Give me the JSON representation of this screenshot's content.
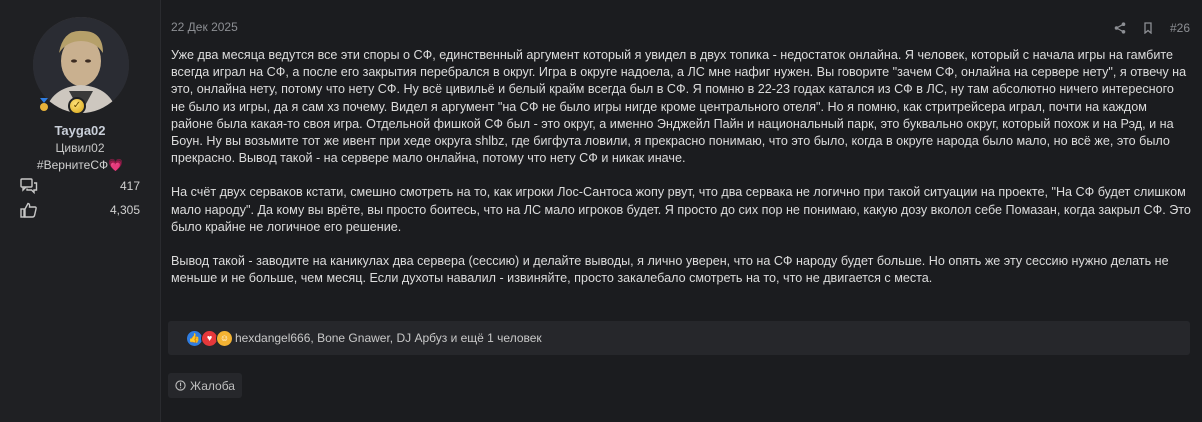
{
  "user": {
    "name": "Tayga02",
    "title": "Цивил02",
    "tag": "#ВернитеСФ",
    "tag_emoji": "💗",
    "messages_count": "417",
    "reactions_count": "4,305"
  },
  "post": {
    "date": "22 Дек 2025",
    "number": "#26",
    "paragraphs": [
      "Уже два месяца ведутся все эти споры о СФ, единственный аргумент который я увидел в двух топика - недостаток онлайна. Я человек, который с начала игры на гамбите всегда играл на СФ, а после его закрытия перебрался в округ. Игра в округе надоела, а ЛС мне нафиг нужен. Вы говорите \"зачем СФ, онлайна на сервере нету\", я отвечу на это, онлайна нету, потому что нету СФ. Ну всё цивильё и белый крайм всегда был в СФ. Я помню в 22-23 годах катался из СФ в ЛС, ну там абсолютно ничего интересного не было из игры, да я сам хз почему. Видел я аргумент \"на СФ не было игры нигде кроме центрального отеля\". Но я помню, как стритрейсера играл, почти на каждом районе была какая-то своя игра. Отдельной фишкой СФ был - это округ, а именно Энджейл Пайн и национальный парк, это буквально округ, который похож и на Рэд, и на Боун. Ну вы возьмите тот же ивент при хеде округа shlbz, где бигфута ловили, я прекрасно понимаю, что это было, когда в округе народа было мало, но всё же, это было прекрасно. Вывод такой - на сервере мало онлайна, потому что нету СФ и никак иначе.",
      "На счёт двух серваков кстати, смешно смотреть на то, как игроки Лос-Сантоса жопу рвут, что два сервака не логично при такой ситуации на проекте, \"На СФ будет слишком мало народу\". Да кому вы врёте, вы просто боитесь, что на ЛС мало игроков будет. Я просто до сих пор не понимаю, какую дозу вколол себе Помазан, когда закрыл СФ. Это было крайне не логичное его решение.",
      "Вывод такой - заводите на каникулах два сервера (сессию) и делайте выводы, я лично уверен, что на СФ народу будет больше. Но опять же эту сессию нужно делать не меньше и не больше, чем месяц. Если духоты навалил - извиняйте, просто закалебало смотреть на то, что не двигается с места."
    ]
  },
  "reactions": {
    "text": "hexdangel666, Bone Gnawer, DJ Арбуз и ещё 1 человек",
    "icons": [
      "like",
      "heart",
      "laugh"
    ]
  },
  "report_label": "Жалоба",
  "icons": {
    "messages": "speech-bubbles-icon",
    "reactions": "thumbs-up-icon",
    "share": "share-icon",
    "bookmark": "bookmark-icon",
    "report": "info-circle-icon"
  }
}
